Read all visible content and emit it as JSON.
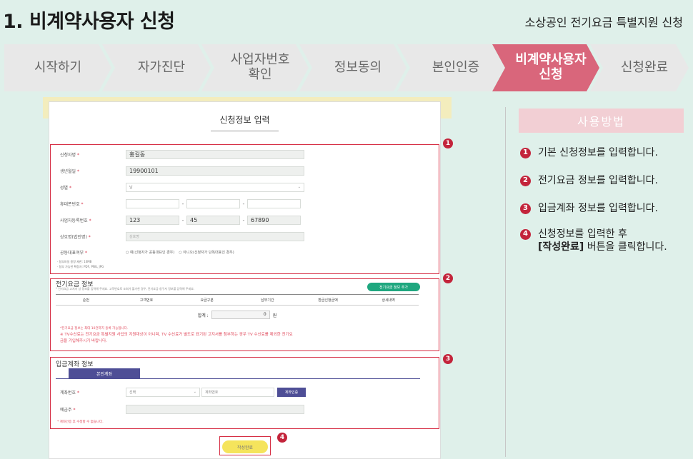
{
  "header": {
    "title": "1. 비계약사용자 신청",
    "subtitle": "소상공인 전기요금 특별지원 신청"
  },
  "steps": [
    "시작하기",
    "자가진단",
    "사업자번호\n확인",
    "정보동의",
    "본인인증",
    "비계약사용자\n신청",
    "신청완료"
  ],
  "active_step_index": 5,
  "form": {
    "title": "신청정보 입력",
    "fields": {
      "applicant_label": "신청자명",
      "applicant_value": "홍길동",
      "birth_label": "생년월일",
      "birth_value": "19900101",
      "gender_label": "성별",
      "gender_value": "남",
      "phone_label": "휴대폰번호",
      "phone_dash": "-",
      "bizno_label": "사업자등록번호",
      "bizno_1": "123",
      "bizno_2": "45",
      "bizno_3": "67890",
      "company_label": "상호명(법인명)",
      "company_placeholder": "상호명",
      "joint_label": "공동대표여부",
      "joint_option_1": "예(신청자가 공동대표인 경우)",
      "joint_option_2": "아니오(신청자가 단독대표인 경우)",
      "required_mark": "*"
    },
    "notes_1": [
      "· 첨부파일 용량 제한: 10MB",
      "· 첨부 가능한 확장자: PDF, PNG, JPG"
    ],
    "electric": {
      "title": "전기요금 정보",
      "desc": "* 전기요금 고지서 상 정보를 입력해 주세요. 고객번호로 조회가 불가한 경우, 전기요금 청구서 정보를 입력해 주세요.",
      "add_button": "전기요금 정보 추가",
      "columns": [
        "순번",
        "고객번호",
        "요금구분",
        "납부기간",
        "환급신청금액",
        "상세내역"
      ],
      "sum_label": "합계 :",
      "sum_value": "0",
      "sum_unit": "원",
      "notes": [
        "*전기요금 정보는 최대 10건까지 등록 가능합니다.",
        "※ TV수신료는 전기요금 특별지원 사업의 지원대상이 아니며, TV 수신료가 별도로 표기된 고지서를 첨부하는 경우 TV 수신료를 제외한 전기요",
        "금을 기입해주시기 바랍니다."
      ]
    },
    "account": {
      "title": "입금계좌 정보",
      "tab": "본인계좌",
      "account_label": "계좌번호",
      "bank_placeholder": "선택",
      "account_placeholder": "계좌번호",
      "verify_button": "계좌인증",
      "holder_label": "예금주",
      "note": "* 계좌인증 후 수정할 수 없습니다."
    },
    "submit_button": "작성완료"
  },
  "badges": [
    "1",
    "2",
    "3",
    "4"
  ],
  "usage": {
    "title": "사용방법",
    "items": [
      {
        "num": "1",
        "text": "기본 신청정보를 입력합니다."
      },
      {
        "num": "2",
        "text": "전기요금 정보를 입력합니다."
      },
      {
        "num": "3",
        "text": "입금계좌 정보를 입력합니다."
      },
      {
        "num": "4",
        "text": "신청정보를 입력한 후",
        "bold": "[작성완료]",
        "text_after": " 버튼을 클릭합니다."
      }
    ]
  },
  "colors": {
    "active_step": "#d9667b",
    "red": "#d62f45",
    "background": "#dff0ea",
    "usage_header": "#f2cfd4"
  }
}
